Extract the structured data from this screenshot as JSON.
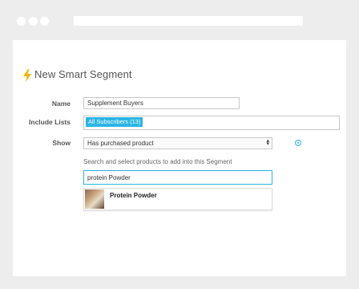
{
  "window": {
    "controls": [
      "close",
      "minimize",
      "maximize"
    ]
  },
  "page": {
    "icon": "lightning-bolt-icon",
    "title": "New Smart Segment"
  },
  "form": {
    "name": {
      "label": "Name",
      "value": "Supplement Buyers"
    },
    "include_lists": {
      "label": "Include Lists",
      "tags": [
        "All Subscribers (13)"
      ]
    },
    "show": {
      "label": "Show",
      "value": "Has purchased product"
    },
    "search": {
      "hint": "Search and select products to add into this Segment",
      "value": "protein Powder"
    },
    "results": [
      {
        "name": "Protein Powder"
      }
    ]
  },
  "colors": {
    "accent": "#2bb5e5",
    "bolt": "#f5b400",
    "frame": "#ededed"
  }
}
